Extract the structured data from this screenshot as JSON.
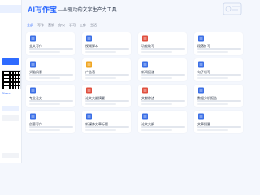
{
  "header": {
    "title": "AI写作宝",
    "subtitle": "---AI驱动的文字生产力工具"
  },
  "tabs": [
    "全部",
    "写作",
    "营销",
    "办公",
    "学习",
    "工作",
    "生活"
  ],
  "sidebar": {
    "items": [
      "",
      "",
      "",
      "",
      ""
    ],
    "qr_label": "Share"
  },
  "cards": [
    {
      "name": "全文写作",
      "icon_color": "#3b6fe6"
    },
    {
      "name": "视频脚本",
      "icon_color": "#3b6fe6"
    },
    {
      "name": "功能改写",
      "icon_color": "#e0503f"
    },
    {
      "name": "段落扩写",
      "icon_color": "#3b6fe6"
    },
    {
      "name": "头脑风暴",
      "icon_color": "#3b6fe6"
    },
    {
      "name": "广告语",
      "icon_color": "#f0a623"
    },
    {
      "name": "新闻报道",
      "icon_color": "#3b6fe6"
    },
    {
      "name": "句子续写",
      "icon_color": "#3b6fe6"
    },
    {
      "name": "专业论文",
      "icon_color": "#3b6fe6"
    },
    {
      "name": "论文大纲摘要",
      "icon_color": "#e0503f"
    },
    {
      "name": "文献综述",
      "icon_color": "#e0503f"
    },
    {
      "name": "数据分析报告",
      "icon_color": "#3b6fe6"
    },
    {
      "name": "创意写作",
      "icon_color": "#3b6fe6"
    },
    {
      "name": "新媒体文章标题",
      "icon_color": "#3b6fe6"
    },
    {
      "name": "论文大纲",
      "icon_color": "#3b6fe6"
    },
    {
      "name": "文章摘要",
      "icon_color": "#3b6fe6"
    }
  ],
  "colors": {
    "accent": "#2f6bff",
    "background": "#f4f7fd"
  }
}
